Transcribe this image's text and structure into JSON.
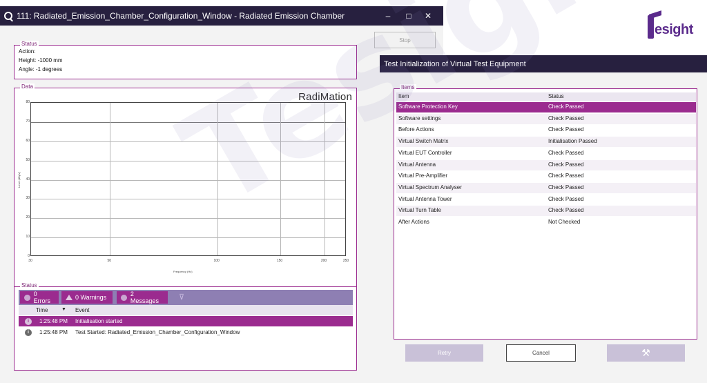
{
  "window": {
    "title": "111: Radiated_Emission_Chamber_Configuration_Window - Radiated Emission Chamber",
    "minimize": "–",
    "maximize": "□",
    "close": "✕"
  },
  "status_top": {
    "label": "Status",
    "action": "Action:",
    "height": "Height: -1000 mm",
    "angle": "Angle: -1 degrees"
  },
  "stop_button": "Stop",
  "data_group": {
    "label": "Data",
    "brand": "RadiMation"
  },
  "chart_data": {
    "type": "line",
    "title": "",
    "xlabel": "Frequency (Hz)",
    "ylabel": "Level (dBµV)",
    "x_ticks": [
      "30",
      "50",
      "100",
      "150",
      "200",
      "250"
    ],
    "y_ticks": [
      "0",
      "10",
      "20",
      "30",
      "40",
      "50",
      "60",
      "70",
      "80"
    ],
    "ylim": [
      0,
      80
    ],
    "grid": true,
    "series": []
  },
  "status_bottom": {
    "label": "Status",
    "filters": {
      "errors": "0 Errors",
      "warnings": "0 Warnings",
      "messages": "2 Messages"
    },
    "columns": {
      "time": "Time",
      "event": "Event"
    },
    "rows": [
      {
        "time": "1:25:48 PM",
        "event": "Initialisation started"
      },
      {
        "time": "1:25:48 PM",
        "event": "Test Started: Radiated_Emission_Chamber_Configuration_Window"
      }
    ]
  },
  "logo": {
    "text": "esight"
  },
  "dialog": {
    "title": "Test Initialization of Virtual Test Equipment",
    "items_label": "Items",
    "columns": {
      "item": "Item",
      "status": "Status"
    },
    "rows": [
      {
        "item": "Software Protection Key",
        "status": "Check Passed"
      },
      {
        "item": "Software settings",
        "status": "Check Passed"
      },
      {
        "item": "Before Actions",
        "status": "Check Passed"
      },
      {
        "item": "Virtual Switch Matrix",
        "status": "Initialisation Passed"
      },
      {
        "item": "Virtual EUT Controller",
        "status": "Check Passed"
      },
      {
        "item": "Virtual Antenna",
        "status": "Check Passed"
      },
      {
        "item": "Virtual Pre-Amplifier",
        "status": "Check Passed"
      },
      {
        "item": "Virtual Spectrum Analyser",
        "status": "Check Passed"
      },
      {
        "item": "Virtual Antenna Tower",
        "status": "Check Passed"
      },
      {
        "item": "Virtual Turn Table",
        "status": "Check Passed"
      },
      {
        "item": "After Actions",
        "status": "Not Checked"
      }
    ],
    "retry": "Retry",
    "cancel": "Cancel",
    "tools_icon": "tools-icon"
  },
  "colors": {
    "titlebar": "#27203f",
    "accent": "#9b2b8f",
    "filterbar": "#8e7fb3"
  }
}
